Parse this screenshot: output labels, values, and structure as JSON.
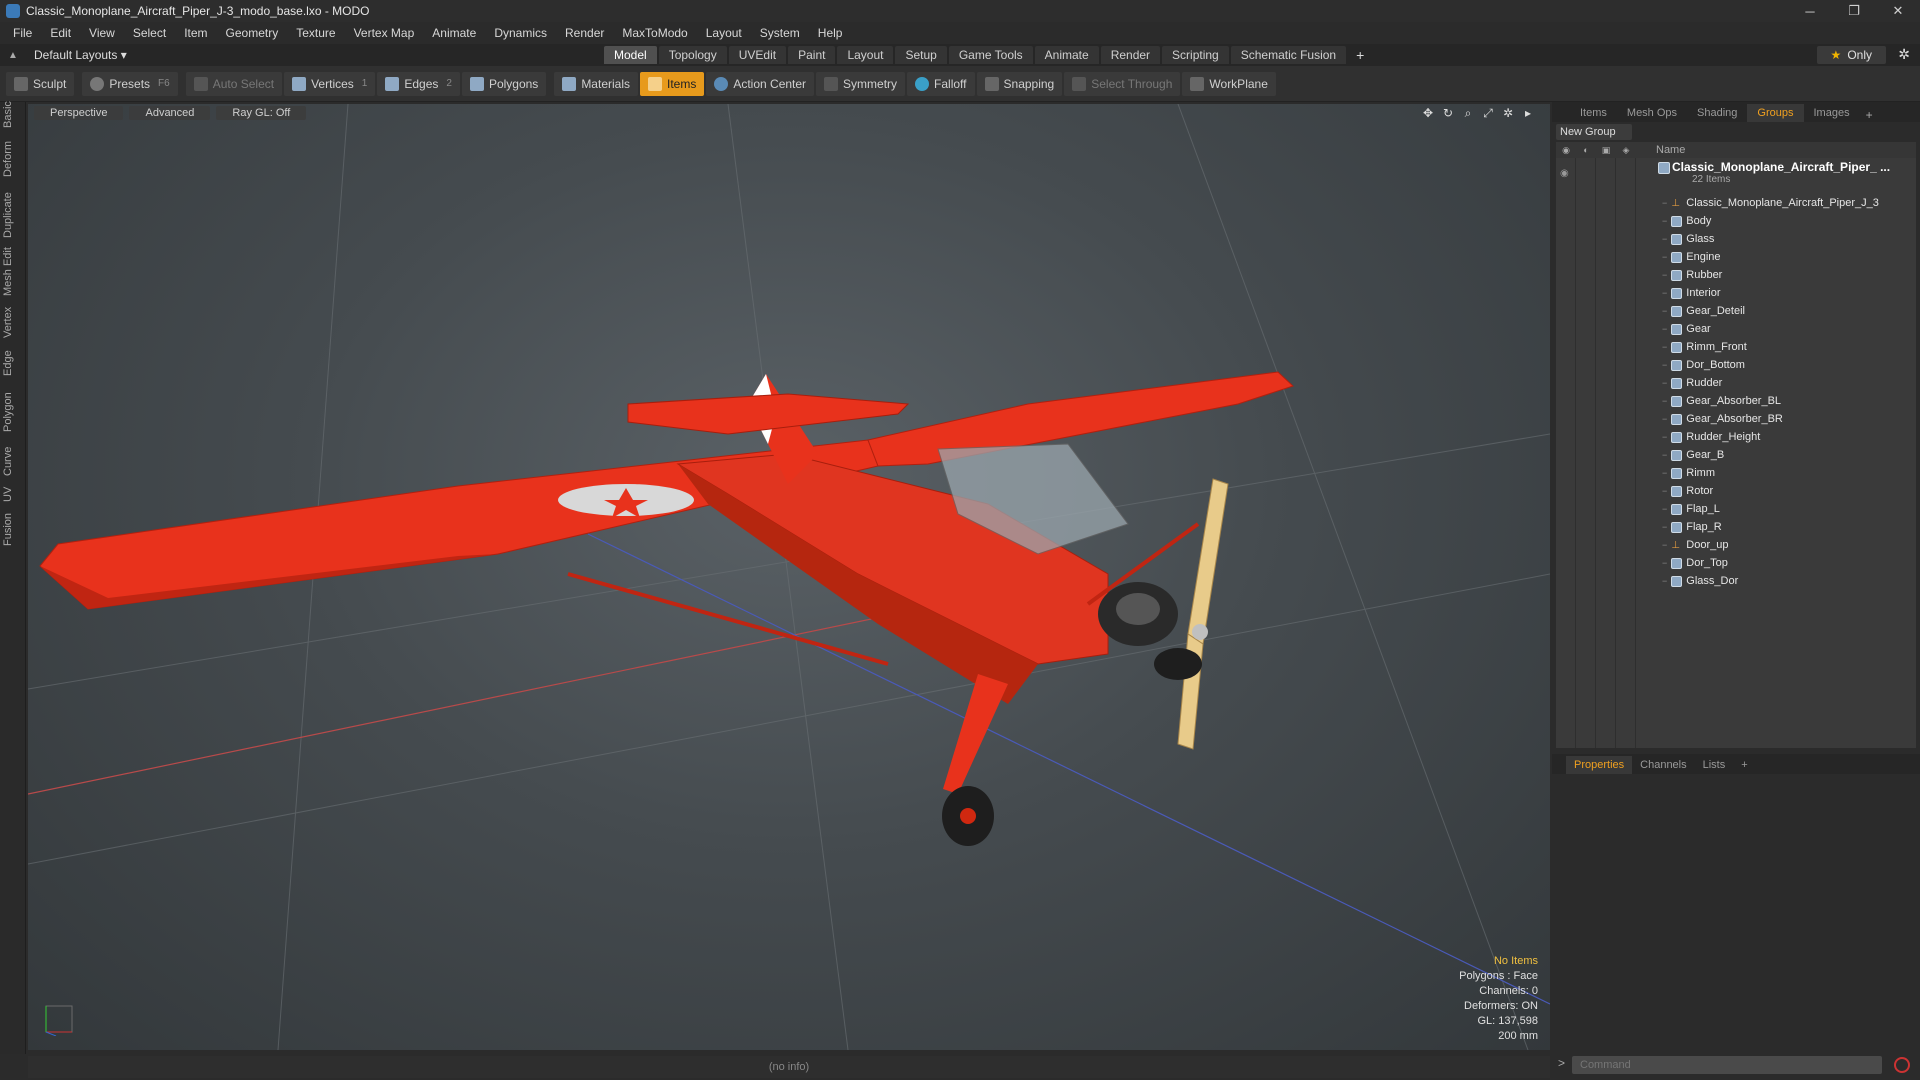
{
  "window": {
    "title": "Classic_Monoplane_Aircraft_Piper_J-3_modo_base.lxo - MODO",
    "controls": [
      "─",
      "❐",
      "✕"
    ]
  },
  "menubar": [
    "File",
    "Edit",
    "View",
    "Select",
    "Item",
    "Geometry",
    "Texture",
    "Vertex Map",
    "Animate",
    "Dynamics",
    "Render",
    "MaxToModo",
    "Layout",
    "System",
    "Help"
  ],
  "layouts": {
    "label": "Default Layouts ▾",
    "tabs": [
      "Model",
      "Topology",
      "UVEdit",
      "Paint",
      "Layout",
      "Setup",
      "Game Tools",
      "Animate",
      "Render",
      "Scripting",
      "Schematic Fusion"
    ],
    "active_tab": "Model",
    "only_label": "Only"
  },
  "toolbar": {
    "sculpt": "Sculpt",
    "presets": "Presets",
    "presets_key": "F6",
    "auto_select": "Auto Select",
    "vertices": "Vertices",
    "vertices_key": "1",
    "edges": "Edges",
    "edges_key": "2",
    "polygons": "Polygons",
    "materials": "Materials",
    "items": "Items",
    "action_center": "Action Center",
    "symmetry": "Symmetry",
    "falloff": "Falloff",
    "snapping": "Snapping",
    "select_through": "Select Through",
    "workplane": "WorkPlane"
  },
  "left_tabs": [
    "Basic",
    "Deform",
    "Duplicate",
    "Mesh Edit",
    "Vertex",
    "Edge",
    "Polygon",
    "Curve",
    "UV",
    "Fusion"
  ],
  "viewport": {
    "perspective": "Perspective",
    "advanced": "Advanced",
    "raygl": "Ray GL: Off",
    "info": {
      "no_items": "No Items",
      "polygons": "Polygons : Face",
      "channels": "Channels: 0",
      "deformers": "Deformers: ON",
      "gl": "GL: 137,598",
      "scale": "200 mm"
    }
  },
  "right_panel": {
    "tabs": [
      "Items",
      "Mesh Ops",
      "Shading",
      "Groups",
      "Images"
    ],
    "active_tab": "Groups",
    "new_group": "New Group",
    "name_header": "Name",
    "group_name": "Classic_Monoplane_Aircraft_Piper_ ...",
    "group_count": "22 Items",
    "items": [
      {
        "name": "Classic_Monoplane_Aircraft_Piper_J_3",
        "icon": "locator"
      },
      {
        "name": "Body",
        "icon": "mesh"
      },
      {
        "name": "Glass",
        "icon": "mesh"
      },
      {
        "name": "Engine",
        "icon": "mesh"
      },
      {
        "name": "Rubber",
        "icon": "mesh"
      },
      {
        "name": "Interior",
        "icon": "mesh"
      },
      {
        "name": "Gear_Deteil",
        "icon": "mesh"
      },
      {
        "name": "Gear",
        "icon": "mesh"
      },
      {
        "name": "Rimm_Front",
        "icon": "mesh"
      },
      {
        "name": "Dor_Bottom",
        "icon": "mesh"
      },
      {
        "name": "Rudder",
        "icon": "mesh"
      },
      {
        "name": "Gear_Absorber_BL",
        "icon": "mesh"
      },
      {
        "name": "Gear_Absorber_BR",
        "icon": "mesh"
      },
      {
        "name": "Rudder_Height",
        "icon": "mesh"
      },
      {
        "name": "Gear_B",
        "icon": "mesh"
      },
      {
        "name": "Rimm",
        "icon": "mesh"
      },
      {
        "name": "Rotor",
        "icon": "mesh"
      },
      {
        "name": "Flap_L",
        "icon": "mesh"
      },
      {
        "name": "Flap_R",
        "icon": "mesh"
      },
      {
        "name": "Door_up",
        "icon": "locator"
      },
      {
        "name": "Dor_Top",
        "icon": "mesh"
      },
      {
        "name": "Glass_Dor",
        "icon": "mesh"
      }
    ]
  },
  "properties": {
    "tabs": [
      "Properties",
      "Channels",
      "Lists"
    ],
    "active_tab": "Properties",
    "command_placeholder": "Command",
    "prompt": ">"
  },
  "statusbar": "(no info)",
  "colors": {
    "accent": "#f0a020",
    "aircraft": "#e8321c",
    "active_tool": "#e79a1c"
  }
}
